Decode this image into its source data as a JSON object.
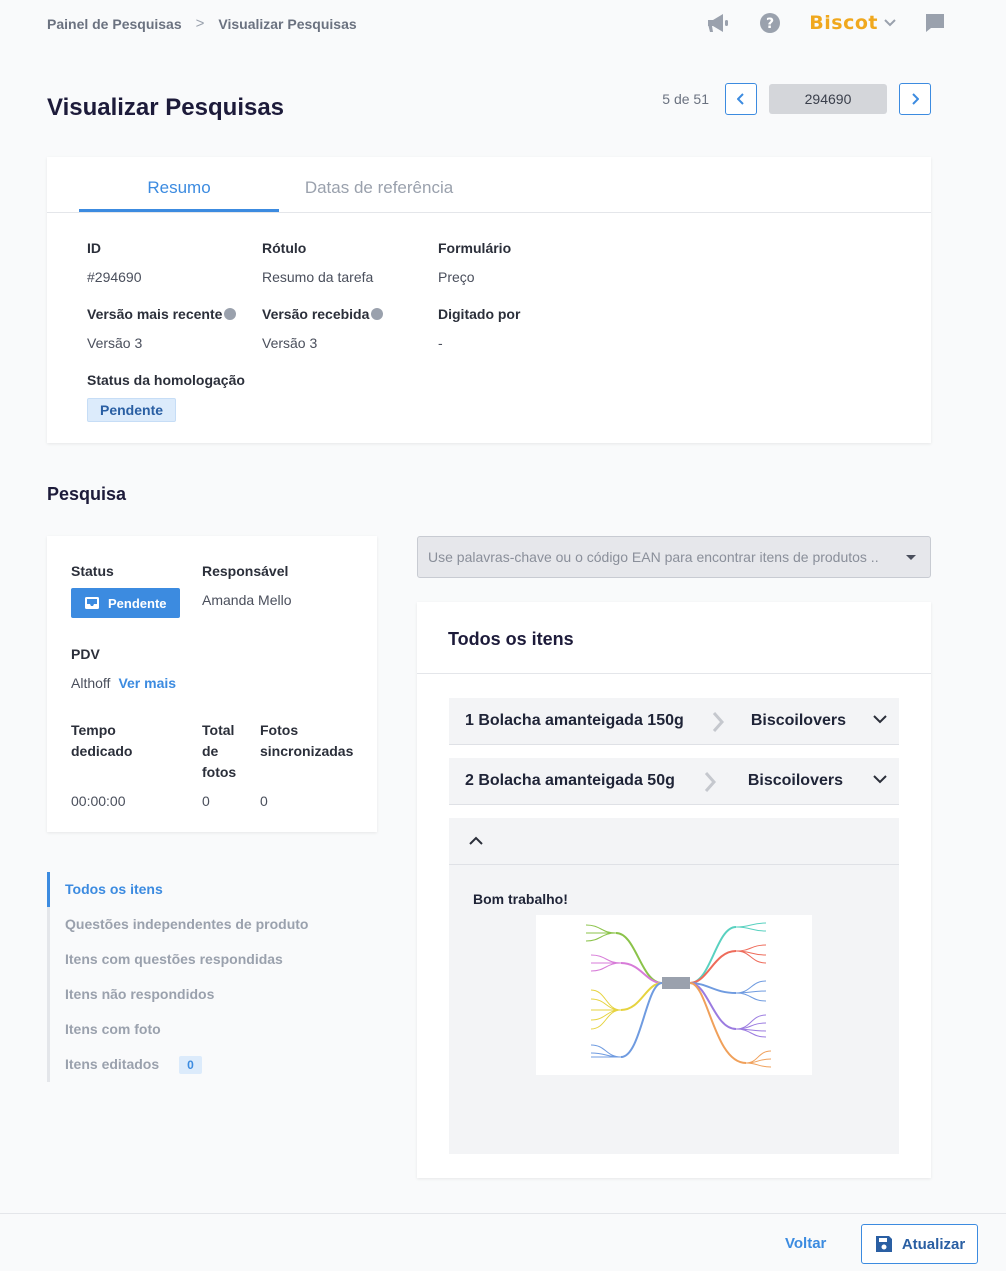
{
  "breadcrumb": {
    "items": [
      "Painel de Pesquisas",
      "Visualizar Pesquisas"
    ]
  },
  "topbar": {
    "brand": "Biscot"
  },
  "header": {
    "title": "Visualizar Pesquisas",
    "pager_count": "5 de 51",
    "current_id": "294690"
  },
  "summary": {
    "tabs": [
      "Resumo",
      "Datas de referência"
    ],
    "fields": {
      "id_label": "ID",
      "id_value": "#294690",
      "rotulo_label": "Rótulo",
      "rotulo_value": "Resumo da tarefa",
      "formulario_label": "Formulário",
      "formulario_value": "Preço",
      "versao_recente_label": "Versão mais recente",
      "versao_recente_value": "Versão 3",
      "versao_recebida_label": "Versão recebida",
      "versao_recebida_value": "Versão 3",
      "digitado_label": "Digitado por",
      "digitado_value": "-",
      "homologacao_label": "Status da homologação",
      "homologacao_value": "Pendente"
    }
  },
  "pesquisa": {
    "title": "Pesquisa",
    "status_label": "Status",
    "status_value": "Pendente",
    "responsavel_label": "Responsável",
    "responsavel_value": "Amanda Mello",
    "pdv_label": "PDV",
    "pdv_value": "Althoff",
    "ver_mais": "Ver mais",
    "tempo_label_1": "Tempo",
    "tempo_label_2": "dedicado",
    "tempo_value": "00:00:00",
    "total_label_1": "Total",
    "total_label_2": "de",
    "total_label_3": "fotos",
    "total_value": "0",
    "fotos_label_1": "Fotos",
    "fotos_label_2": "sincronizadas",
    "fotos_value": "0"
  },
  "filters": {
    "items": [
      "Todos os itens",
      "Questões independentes de produto",
      "Itens com questões respondidas",
      "Itens não respondidos",
      "Itens com foto",
      "Itens editados"
    ],
    "edited_count": "0"
  },
  "search": {
    "placeholder": "Use palavras-chave ou o código EAN para encontrar itens de produtos .."
  },
  "items": {
    "title": "Todos os itens",
    "rows": [
      {
        "name": "1 Bolacha amanteigada 150g",
        "brand": "Biscoilovers"
      },
      {
        "name": "2 Bolacha amanteigada 50g",
        "brand": "Biscoilovers"
      }
    ],
    "expanded_message": "Bom trabalho!"
  },
  "footer": {
    "back": "Voltar",
    "update": "Atualizar"
  },
  "colors": {
    "accent": "#3c8be0",
    "brand": "#f0a81e"
  }
}
